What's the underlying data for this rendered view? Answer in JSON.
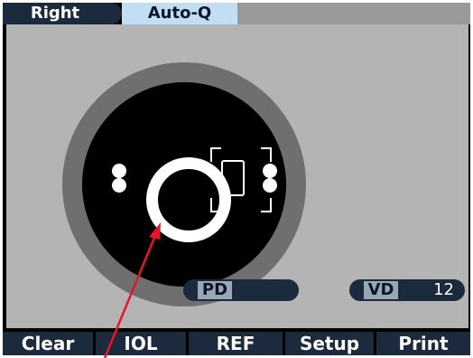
{
  "header": {
    "eye_label": "Right",
    "mode_label": "Auto-Q"
  },
  "readouts": {
    "pd_label": "PD",
    "pd_value": "",
    "vd_label": "VD",
    "vd_value": "12"
  },
  "buttons": [
    {
      "label": "Clear"
    },
    {
      "label": "IOL"
    },
    {
      "label": "REF"
    },
    {
      "label": "Setup"
    },
    {
      "label": "Print"
    }
  ],
  "colors": {
    "panel": "#b4b4b4",
    "header_dark": "#1c2a3e",
    "header_light": "#c2def4",
    "pointer": "#e8142a"
  }
}
